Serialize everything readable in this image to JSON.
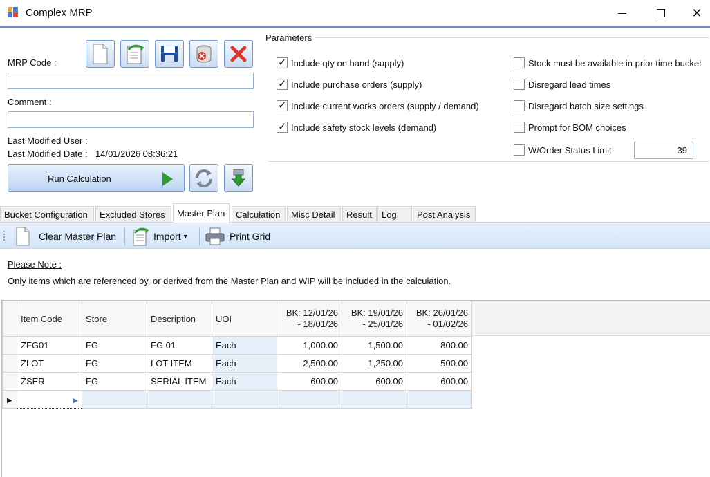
{
  "window": {
    "title": "Complex MRP",
    "controls": {
      "minimize": "minimize-icon",
      "maximize": "maximize-icon",
      "close": "close-icon"
    }
  },
  "form": {
    "mrp_code_label": "MRP Code :",
    "mrp_code_value": "",
    "comment_label": "Comment :",
    "comment_value": "",
    "last_modified_user_label": "Last Modified User :",
    "last_modified_user_value": "",
    "last_modified_date_label": "Last Modified Date :",
    "last_modified_date_value": "14/01/2026 08:36:21",
    "run_calculation_label": "Run Calculation",
    "toolbar_icons": [
      "new-document-icon",
      "open-document-icon",
      "save-icon",
      "delete-database-icon",
      "cancel-x-icon"
    ],
    "extra_icons": [
      "refresh-icon",
      "download-icon"
    ]
  },
  "parameters": {
    "legend": "Parameters",
    "left": [
      {
        "label": "Include qty on hand (supply)",
        "checked": true
      },
      {
        "label": "Include purchase orders (supply)",
        "checked": true
      },
      {
        "label": "Include current works orders (supply / demand)",
        "checked": true
      },
      {
        "label": "Include safety stock levels (demand)",
        "checked": true
      }
    ],
    "right": [
      {
        "label": "Stock must be available in prior time bucket",
        "checked": false
      },
      {
        "label": "Disregard lead times",
        "checked": false
      },
      {
        "label": "Disregard batch size settings",
        "checked": false
      },
      {
        "label": "Prompt for BOM choices",
        "checked": false
      },
      {
        "label": "W/Order Status Limit",
        "checked": false
      }
    ],
    "wo_status_limit_value": "39"
  },
  "tabs": [
    {
      "label": "Bucket Configuration",
      "active": false
    },
    {
      "label": "Excluded Stores",
      "active": false
    },
    {
      "label": "Master Plan",
      "active": true
    },
    {
      "label": "Calculation",
      "active": false
    },
    {
      "label": "Misc Detail",
      "active": false
    },
    {
      "label": "Result",
      "active": false
    },
    {
      "label": "Log",
      "active": false
    },
    {
      "label": "Post Analysis",
      "active": false
    }
  ],
  "master_plan_toolbar": {
    "clear_label": "Clear Master Plan",
    "import_label": "Import",
    "print_label": "Print Grid"
  },
  "note": {
    "title": "Please Note :",
    "text": "Only items which are referenced by, or derived from the Master Plan and WIP will be included in the calculation."
  },
  "grid": {
    "columns": [
      "Item Code",
      "Store",
      "Description",
      "UOI",
      "BK: 12/01/26\n- 18/01/26",
      "BK: 19/01/26\n- 25/01/26",
      "BK: 26/01/26\n- 01/02/26"
    ],
    "rows": [
      [
        "ZFG01",
        "FG",
        "FG 01",
        "Each",
        "1,000.00",
        "1,500.00",
        "800.00"
      ],
      [
        "ZLOT",
        "FG",
        "LOT ITEM",
        "Each",
        "2,500.00",
        "1,250.00",
        "500.00"
      ],
      [
        "ZSER",
        "FG",
        "SERIAL ITEM",
        "Each",
        "600.00",
        "600.00",
        "600.00"
      ]
    ]
  }
}
